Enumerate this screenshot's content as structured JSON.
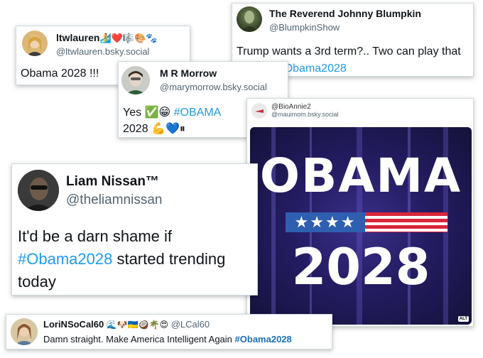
{
  "posts": {
    "blumpkin": {
      "name": "The Reverend Johnny Blumpkin",
      "handle": "@BlumpkinShow",
      "text_before": "Trump wants a 3rd term?.. Two can play that game...",
      "hashtag": "#Obama2028"
    },
    "ltwlauren": {
      "name": "ltwlauren",
      "name_emojis": "🏄❤️🎼🎨🐾",
      "handle": "@ltwlauren.bsky.social",
      "text": "Obama 2028 !!!"
    },
    "morrow": {
      "name": "M R Morrow",
      "handle": "@marymorrow.bsky.social",
      "text_yes": "Yes",
      "emoji_line1": "✅😁",
      "hashtag": "#OBAMA",
      "text_year": "2028",
      "emoji_line2": "💪💙⏸"
    },
    "bioannie": {
      "name": "@BioAnnie2",
      "handle": "@mauimom.bsky.social",
      "image": {
        "headline": "OBAMA",
        "year": "2028",
        "stars": "★★★★",
        "badge": "ALT"
      }
    },
    "nissan": {
      "name": "Liam Nissan™",
      "handle": "@theliamnissan",
      "text_before": "It'd be a darn shame if",
      "hashtag": "#Obama2028",
      "text_after": "started trending today"
    },
    "lori": {
      "name": "LoriNSoCal60",
      "name_emojis": "🌊🐶🇺🇦🥥🌴😍",
      "handle": "@LCal60",
      "text_before": "Damn straight. Make America Intelligent Again",
      "hashtag": "#Obama2028"
    }
  },
  "colors": {
    "link": "#1d9bf0",
    "poster_bg": "#1c1c5e",
    "flag_blue": "#2f5fb0",
    "flag_red": "#d8263a"
  }
}
